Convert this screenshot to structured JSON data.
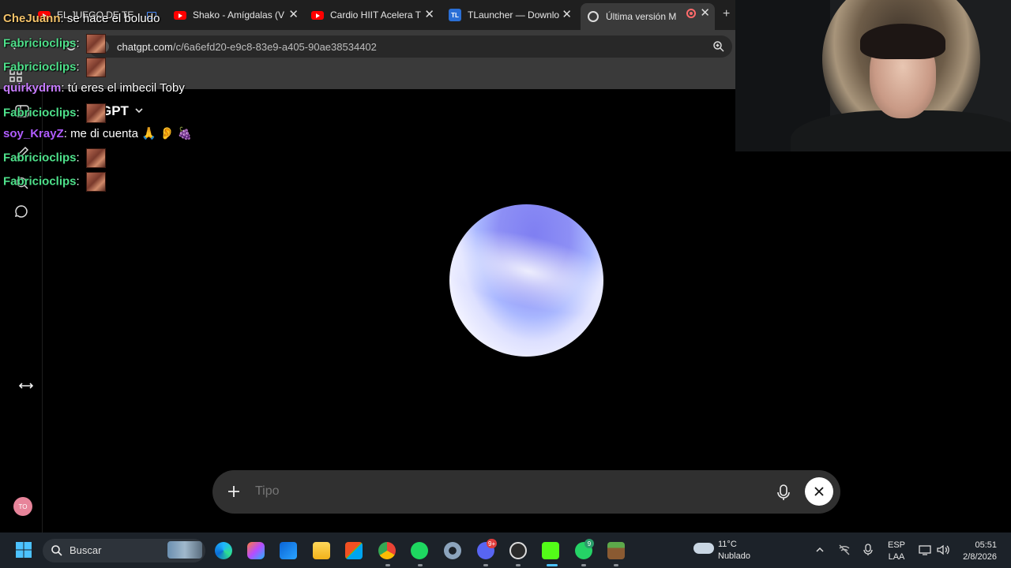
{
  "browser": {
    "tabs": [
      {
        "title": "EL JUEGO DE TE",
        "type": "youtube",
        "active": false
      },
      {
        "title": "Shako - Amígdalas (V",
        "type": "youtube",
        "active": false
      },
      {
        "title": "Cardio HIIT Acelera T",
        "type": "youtube",
        "active": false
      },
      {
        "title": "TLauncher — Downlo",
        "type": "tlauncher",
        "active": false
      },
      {
        "title": "Última versión M",
        "type": "chatgpt",
        "active": true
      }
    ],
    "close_symbol": "✕",
    "new_tab_symbol": "+",
    "tlauncher_badge": "TL",
    "url_host": "chatgpt.com",
    "url_path": "/c/6a6efd20-e9c8-83e9-a405-90ae38534402"
  },
  "chatgpt": {
    "model_name": "GPT",
    "composer_placeholder": "Tipo",
    "avatar_initials": "TO"
  },
  "chat_overlay": [
    {
      "user": "CheJuann",
      "color": "#f2c26a",
      "message": "se hace el boludo",
      "emote": false
    },
    {
      "user": "Fabricioclips",
      "color": "#4ee08a",
      "message": "",
      "emote": true
    },
    {
      "user": "Fabricioclips",
      "color": "#4ee08a",
      "message": "",
      "emote": true
    },
    {
      "user": "quirkydrm",
      "color": "#c77dff",
      "message": "tú eres el imbecil Toby",
      "emote": false
    },
    {
      "user": "Fabricioclips",
      "color": "#4ee08a",
      "message": "",
      "emote": true
    },
    {
      "user": "soy_KrayZ",
      "color": "#b05cff",
      "message": "me di cuenta 🙏 👂 🍇",
      "emote": false
    },
    {
      "user": "Fabricioclips",
      "color": "#4ee08a",
      "message": "",
      "emote": true
    },
    {
      "user": "Fabricioclips",
      "color": "#4ee08a",
      "message": "",
      "emote": true
    }
  ],
  "taskbar": {
    "search_label": "Buscar",
    "weather_temp": "11°C",
    "weather_desc": "Nublado",
    "language": "ESP",
    "layout": "LAA",
    "time": "05:51",
    "date": "2/8/2026",
    "chrome_badge": "",
    "discord_badge": "9+",
    "whatsapp_badge": "9"
  },
  "colors": {
    "accent_green": "#4ee08a",
    "orb_top": "#7f7ff2",
    "orb_bottom": "#f4f4ff"
  }
}
